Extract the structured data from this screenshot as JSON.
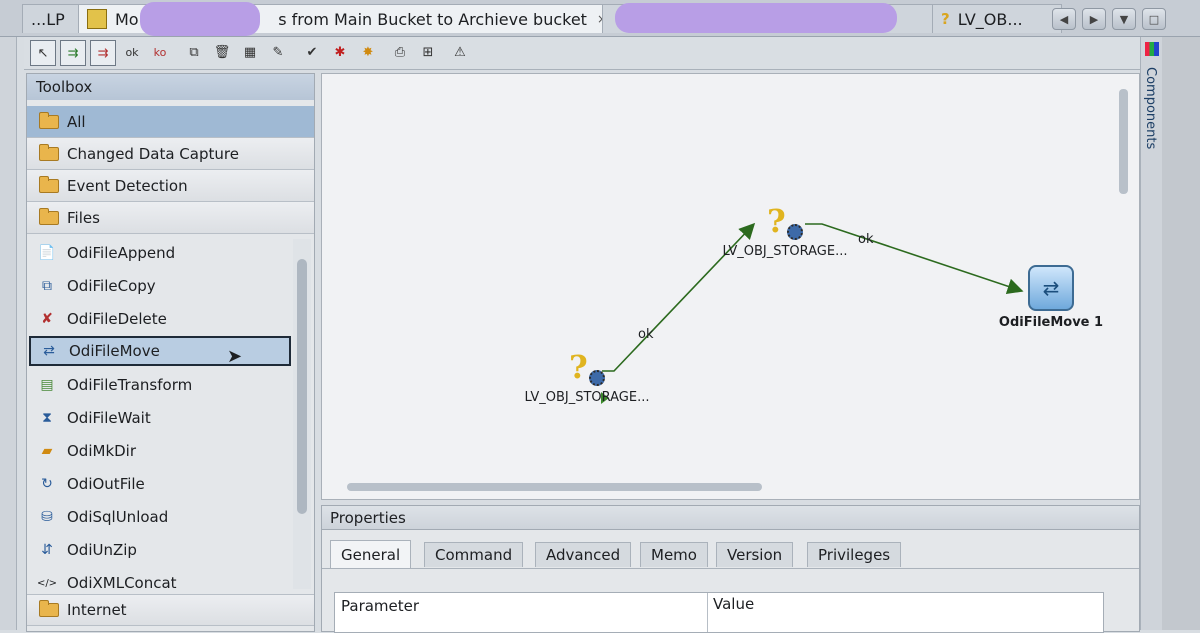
{
  "tabs": [
    {
      "label": "...LP"
    },
    {
      "label": "Mo",
      "label_tail": "s from Main Bucket to Archieve bucket",
      "close": "×"
    },
    {
      "label": "LV_OB..."
    }
  ],
  "toolbox": {
    "title": "Toolbox",
    "categories": [
      {
        "label": "All"
      },
      {
        "label": "Changed Data Capture"
      },
      {
        "label": "Event Detection"
      },
      {
        "label": "Files"
      },
      {
        "label": "Internet"
      }
    ],
    "items": [
      {
        "label": "OdiFileAppend",
        "icon": "file-append-icon"
      },
      {
        "label": "OdiFileCopy",
        "icon": "file-copy-icon"
      },
      {
        "label": "OdiFileDelete",
        "icon": "file-delete-icon"
      },
      {
        "label": "OdiFileMove",
        "icon": "file-move-icon"
      },
      {
        "label": "OdiFileTransform",
        "icon": "file-transform-icon"
      },
      {
        "label": "OdiFileWait",
        "icon": "file-wait-icon"
      },
      {
        "label": "OdiMkDir",
        "icon": "mkdir-icon"
      },
      {
        "label": "OdiOutFile",
        "icon": "outfile-icon"
      },
      {
        "label": "OdiSqlUnload",
        "icon": "sql-unload-icon"
      },
      {
        "label": "OdiUnZip",
        "icon": "unzip-icon"
      },
      {
        "label": "OdiXMLConcat",
        "icon": "xml-concat-icon"
      }
    ]
  },
  "toolbar": {
    "ok": "ok",
    "ko": "ko"
  },
  "diagram": {
    "nodes": [
      {
        "label": "LV_OBJ_STORAGE..."
      },
      {
        "label": "LV_OBJ_STORAGE..."
      },
      {
        "label": "OdiFileMove 1"
      }
    ],
    "links": [
      {
        "label": "ok"
      },
      {
        "label": "ok"
      }
    ]
  },
  "properties": {
    "title": "Properties",
    "tabs": [
      "General",
      "Command",
      "Advanced",
      "Memo",
      "Version",
      "Privileges"
    ],
    "columns": [
      "Parameter",
      "Value"
    ]
  },
  "sidebar": {
    "components": "Components"
  }
}
